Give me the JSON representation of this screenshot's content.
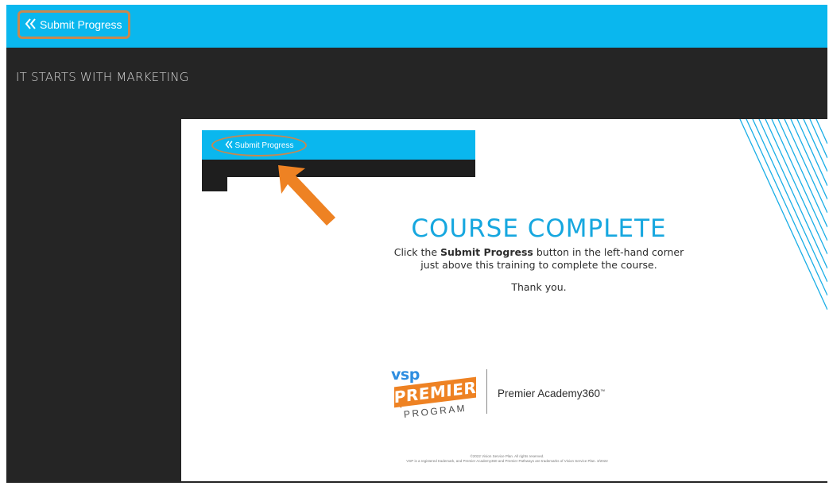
{
  "header": {
    "back_button_label": "Submit Progress",
    "accent_color": "#0ab7ee",
    "highlight_color": "#c9884e"
  },
  "course": {
    "title": "IT STARTS WITH MARKETING"
  },
  "slide": {
    "mini_button_label": "Submit Progress",
    "heading": "COURSE COMPLETE",
    "instructions_before": "Click the ",
    "instructions_bold": "Submit Progress",
    "instructions_after": " button in the left-hand corner",
    "instructions_line2": "just above this training to complete the course.",
    "thanks": "Thank you.",
    "logo": {
      "vsp": "vsp",
      "premier": "PREMIER",
      "program": "PROGRAM",
      "academy": "Premier Academy360",
      "academy_mark": "™"
    },
    "legal_line1": "©2022 Vision Service Plan. All rights reserved.",
    "legal_line2": "VSP is a registered trademark, and Premier Academy360 and Premier Pathways are trademarks of Vision Service Plan. 3/2022"
  },
  "icons": {
    "back": "chevrons-left-icon",
    "pointer": "orange-arrow-icon"
  }
}
